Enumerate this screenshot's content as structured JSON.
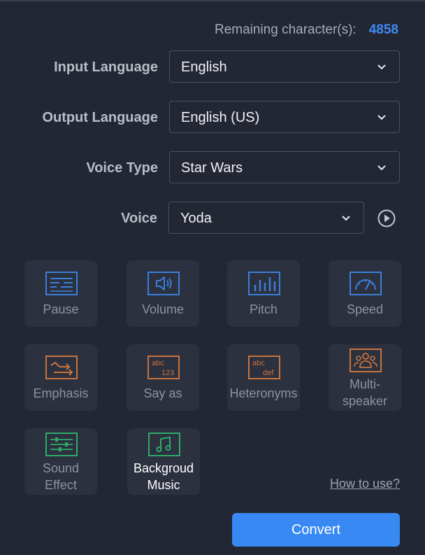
{
  "remaining": {
    "label": "Remaining character(s):",
    "count": "4858"
  },
  "fields": {
    "input_language": {
      "label": "Input Language",
      "value": "English"
    },
    "output_language": {
      "label": "Output Language",
      "value": "English (US)"
    },
    "voice_type": {
      "label": "Voice Type",
      "value": "Star Wars"
    },
    "voice": {
      "label": "Voice",
      "value": "Yoda"
    }
  },
  "tools": [
    {
      "label": "Pause",
      "icon": "pause-icon"
    },
    {
      "label": "Volume",
      "icon": "volume-icon"
    },
    {
      "label": "Pitch",
      "icon": "pitch-icon"
    },
    {
      "label": "Speed",
      "icon": "speed-icon"
    },
    {
      "label": "Emphasis",
      "icon": "emphasis-icon"
    },
    {
      "label": "Say as",
      "icon": "say-as-icon"
    },
    {
      "label": "Heteronyms",
      "icon": "heteronyms-icon"
    },
    {
      "label_line1": "Multi-",
      "label_line2": "speaker",
      "icon": "multi-speaker-icon"
    },
    {
      "label_line1": "Sound",
      "label_line2": "Effect",
      "icon": "sound-effect-icon"
    },
    {
      "label_line1": "Backgroud",
      "label_line2": "Music",
      "icon": "music-icon"
    }
  ],
  "icon_texts": {
    "say_as_top": "abc",
    "say_as_bottom": "123",
    "heteronyms_top": "abc",
    "heteronyms_bottom": "def"
  },
  "how_to_use": "How to use?",
  "convert_label": "Convert",
  "colors": {
    "accent": "#3889f3",
    "count": "#3d8af7",
    "blue_icon": "#3b7fd9",
    "orange_icon": "#c9733a",
    "green_icon": "#2faa6a",
    "background": "#232733",
    "tile": "#2c313f"
  }
}
